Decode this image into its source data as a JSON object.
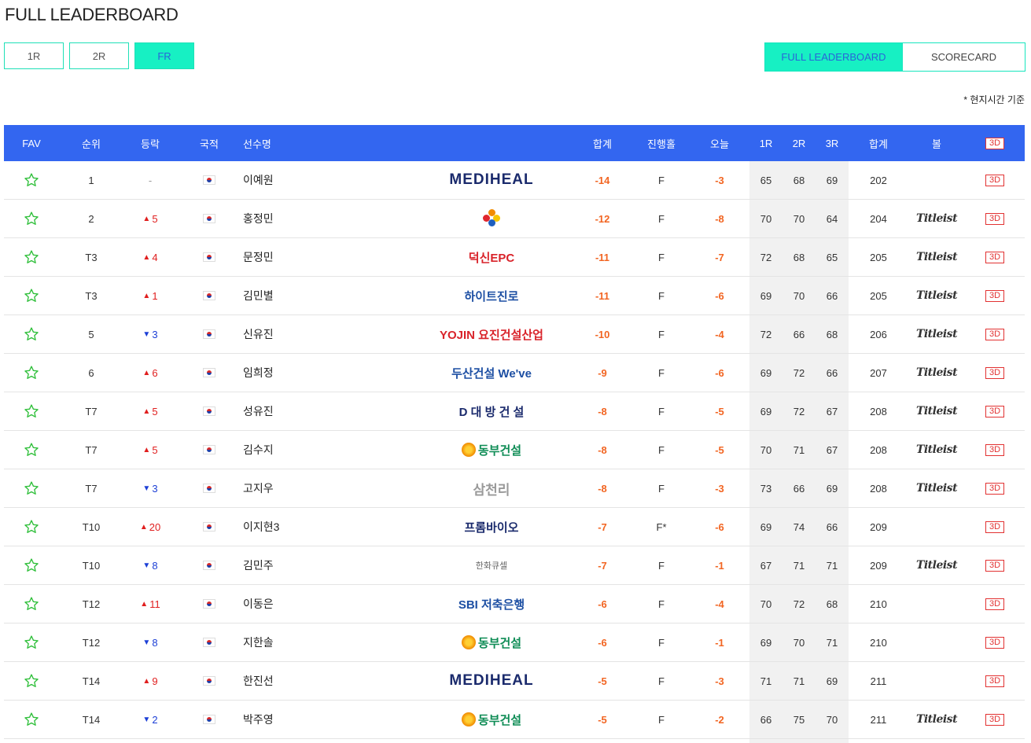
{
  "page": {
    "title": "FULL LEADERBOARD",
    "time_note": "* 현지시간 기준"
  },
  "round_tabs": [
    {
      "label": "1R",
      "active": false
    },
    {
      "label": "2R",
      "active": false
    },
    {
      "label": "FR",
      "active": true
    }
  ],
  "view_tabs": [
    {
      "label": "FULL LEADERBOARD",
      "active": true
    },
    {
      "label": "SCORECARD",
      "active": false
    }
  ],
  "columns": {
    "fav": "FAV",
    "rank": "순위",
    "move": "등락",
    "nation": "국적",
    "name": "선수명",
    "total": "합계",
    "hole": "진행홀",
    "today": "오늘",
    "r1": "1R",
    "r2": "2R",
    "r3": "3R",
    "sum": "합계",
    "ball": "볼",
    "btn3d": "3D"
  },
  "colors": {
    "header": "#3366f0",
    "accent": "#17f0c3",
    "score": "#f26522",
    "up": "#e01e1e",
    "down": "#1c3fd6"
  },
  "rows": [
    {
      "rank": "1",
      "move": "-",
      "dir": "none",
      "name": "이예원",
      "sponsor": "MEDIHEAL",
      "sponsor_style": "mediheal",
      "total": "-14",
      "hole": "F",
      "today": "-3",
      "r1": "65",
      "r2": "68",
      "r3": "69",
      "sum": "202",
      "ball": ""
    },
    {
      "rank": "2",
      "move": "5",
      "dir": "up",
      "name": "홍정민",
      "sponsor": "CJ",
      "sponsor_style": "cj",
      "total": "-12",
      "hole": "F",
      "today": "-8",
      "r1": "70",
      "r2": "70",
      "r3": "64",
      "sum": "204",
      "ball": "Titleist"
    },
    {
      "rank": "T3",
      "move": "4",
      "dir": "up",
      "name": "문정민",
      "sponsor": "덕신EPC",
      "sponsor_style": "red",
      "total": "-11",
      "hole": "F",
      "today": "-7",
      "r1": "72",
      "r2": "68",
      "r3": "65",
      "sum": "205",
      "ball": "Titleist"
    },
    {
      "rank": "T3",
      "move": "1",
      "dir": "up",
      "name": "김민별",
      "sponsor": "하이트진로",
      "sponsor_style": "blue",
      "total": "-11",
      "hole": "F",
      "today": "-6",
      "r1": "69",
      "r2": "70",
      "r3": "66",
      "sum": "205",
      "ball": "Titleist"
    },
    {
      "rank": "5",
      "move": "3",
      "dir": "down",
      "name": "신유진",
      "sponsor": "YOJIN 요진건설산업",
      "sponsor_style": "red",
      "total": "-10",
      "hole": "F",
      "today": "-4",
      "r1": "72",
      "r2": "66",
      "r3": "68",
      "sum": "206",
      "ball": "Titleist"
    },
    {
      "rank": "6",
      "move": "6",
      "dir": "up",
      "name": "임희정",
      "sponsor": "두산건설 We've",
      "sponsor_style": "blue",
      "total": "-9",
      "hole": "F",
      "today": "-6",
      "r1": "69",
      "r2": "72",
      "r3": "66",
      "sum": "207",
      "ball": "Titleist"
    },
    {
      "rank": "T7",
      "move": "5",
      "dir": "up",
      "name": "성유진",
      "sponsor": "D 대 방 건 설",
      "sponsor_style": "navy",
      "total": "-8",
      "hole": "F",
      "today": "-5",
      "r1": "69",
      "r2": "72",
      "r3": "67",
      "sum": "208",
      "ball": "Titleist"
    },
    {
      "rank": "T7",
      "move": "5",
      "dir": "up",
      "name": "김수지",
      "sponsor": "동부건설",
      "sponsor_style": "dongbu",
      "total": "-8",
      "hole": "F",
      "today": "-5",
      "r1": "70",
      "r2": "71",
      "r3": "67",
      "sum": "208",
      "ball": "Titleist"
    },
    {
      "rank": "T7",
      "move": "3",
      "dir": "down",
      "name": "고지우",
      "sponsor": "삼천리",
      "sponsor_style": "gray",
      "total": "-8",
      "hole": "F",
      "today": "-3",
      "r1": "73",
      "r2": "66",
      "r3": "69",
      "sum": "208",
      "ball": "Titleist"
    },
    {
      "rank": "T10",
      "move": "20",
      "dir": "up",
      "name": "이지현3",
      "sponsor": "프롬바이오",
      "sponsor_style": "navy",
      "total": "-7",
      "hole": "F*",
      "today": "-6",
      "r1": "69",
      "r2": "74",
      "r3": "66",
      "sum": "209",
      "ball": ""
    },
    {
      "rank": "T10",
      "move": "8",
      "dir": "down",
      "name": "김민주",
      "sponsor": "한화큐셀",
      "sponsor_style": "small",
      "total": "-7",
      "hole": "F",
      "today": "-1",
      "r1": "67",
      "r2": "71",
      "r3": "71",
      "sum": "209",
      "ball": "Titleist"
    },
    {
      "rank": "T12",
      "move": "11",
      "dir": "up",
      "name": "이동은",
      "sponsor": "SBI 저축은행",
      "sponsor_style": "blue",
      "total": "-6",
      "hole": "F",
      "today": "-4",
      "r1": "70",
      "r2": "72",
      "r3": "68",
      "sum": "210",
      "ball": ""
    },
    {
      "rank": "T12",
      "move": "8",
      "dir": "down",
      "name": "지한솔",
      "sponsor": "동부건설",
      "sponsor_style": "dongbu",
      "total": "-6",
      "hole": "F",
      "today": "-1",
      "r1": "69",
      "r2": "70",
      "r3": "71",
      "sum": "210",
      "ball": ""
    },
    {
      "rank": "T14",
      "move": "9",
      "dir": "up",
      "name": "한진선",
      "sponsor": "MEDIHEAL",
      "sponsor_style": "mediheal",
      "total": "-5",
      "hole": "F",
      "today": "-3",
      "r1": "71",
      "r2": "71",
      "r3": "69",
      "sum": "211",
      "ball": ""
    },
    {
      "rank": "T14",
      "move": "2",
      "dir": "down",
      "name": "박주영",
      "sponsor": "동부건설",
      "sponsor_style": "dongbu",
      "total": "-5",
      "hole": "F",
      "today": "-2",
      "r1": "66",
      "r2": "75",
      "r3": "70",
      "sum": "211",
      "ball": "Titleist"
    }
  ]
}
